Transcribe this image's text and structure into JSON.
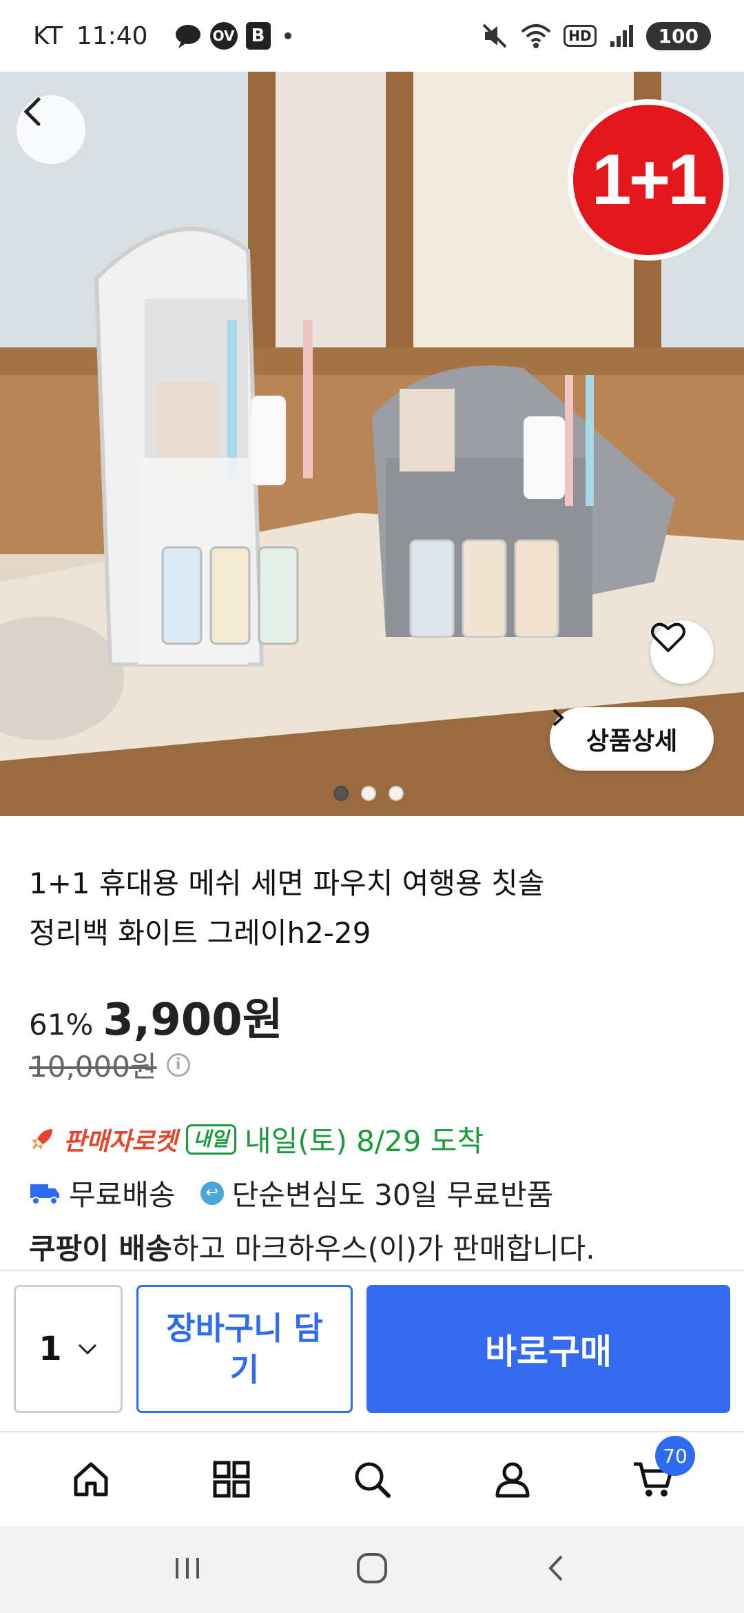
{
  "status_bar": {
    "carrier": "KT",
    "time": "11:40",
    "icon_badge_ov": "OV",
    "icon_badge_b": "B",
    "hd": "HD",
    "battery": "100"
  },
  "hero": {
    "promo_badge": "1+1",
    "detail_button": "상품상세",
    "pager_total": 3,
    "pager_active": 1
  },
  "product": {
    "title_line1": "1+1 휴대용 메쉬 세면 파우치 여행용 칫솔",
    "title_line2": "정리백 화이트 그레이h2-29",
    "discount": "61%",
    "price": "3,900원",
    "original_price": "10,000원"
  },
  "delivery": {
    "rocket_label": "판매자로켓",
    "tomorrow_badge": "내일",
    "arrival": "내일(토) 8/29 도착",
    "free_shipping": "무료배송",
    "free_return": "단순변심도 30일 무료반품",
    "seller_bold": "쿠팡이 배송",
    "seller_rest": "하고 마크하우스(이)가 판매합니다."
  },
  "purchase": {
    "quantity": "1",
    "cart_button": "장바구니 담기",
    "buy_button": "바로구매"
  },
  "tabs": {
    "cart_count": "70"
  },
  "colors": {
    "primary_blue": "#346aef",
    "rocket_red": "#e5452a",
    "arrival_green": "#1a9a3a",
    "promo_red": "#e3161b"
  }
}
